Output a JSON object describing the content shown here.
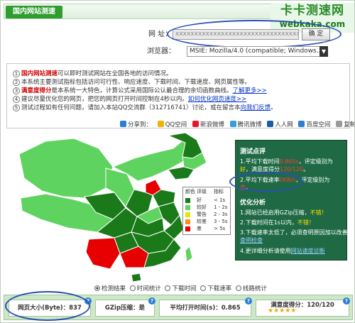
{
  "header": {
    "title": "国内网站测速",
    "logo_cn": "卡卡测速网",
    "logo_en": "webkaka.com"
  },
  "form": {
    "url_label": "网  址：",
    "url_value": "xxxxxxxxxxxxxxxxxxxxxxxxxxxxxxxxxxxx",
    "submit_label": "确 定",
    "browser_label": "浏览器：",
    "browser_value": "MSIE: Mozilla/4.0 (compatible; Windows..."
  },
  "info": {
    "lines": [
      {
        "num": "1",
        "strong": "国内网站测速",
        "rest": "可以即时测试网站在全国各地的访问情况。"
      },
      {
        "num": "2",
        "text": "本系统主要测试指标包括访问可行性、响应速度、下载时间、下载速度、网页属性等。"
      },
      {
        "num": "3",
        "strong": "满意度得分",
        "rest": "是本系统一大特色，计算公式采用国际公认最合理的余切函数曲线。",
        "link": "了解更多>>"
      },
      {
        "num": "4",
        "text": "建议尽量优化您的网页，把您的网页打开时间控制在4秒以内。",
        "link": "如何优化网页速度>>"
      },
      {
        "num": "5",
        "text": "测试过程如有任何问题，请加入本站QQ交流群（312716741）讨论，或在留言本",
        "link": "向我们反馈",
        "tail": "。"
      }
    ]
  },
  "share": {
    "label": "分享到：",
    "items": [
      "QQ空间",
      "新浪微博",
      "腾讯微博",
      "人人网",
      "百度空间",
      "复制"
    ]
  },
  "legend": {
    "headers": [
      "颜色",
      "评级",
      "指标"
    ],
    "rows": [
      {
        "rating": "好",
        "metric": "< 1s",
        "color": "#1a7a1a"
      },
      {
        "rating": "较好",
        "metric": "1 - 2s",
        "color": "#5fd35f"
      },
      {
        "rating": "警告",
        "metric": "2 - 3s",
        "color": "#e6e600"
      },
      {
        "rating": "较差",
        "metric": "3 - 5s",
        "color": "#ff8c1a"
      },
      {
        "rating": "差",
        "metric": "> 5s",
        "color": "#e60000"
      }
    ]
  },
  "result": {
    "title": "测试点评",
    "line1a": "1.平均下载时间",
    "line1_value": "0.865s",
    "line1b": "，评定级别为",
    "line1c": "好",
    "line1d": "，满意度得分",
    "line1_score": "120/120",
    "line1e": "。",
    "line2a": "2.平均下载速率",
    "line2_value": "0KB/s",
    "line2b": "，评定级别为",
    "line2c": "差",
    "line2d": "。",
    "opt_title": "优化分析",
    "opt1a": "1.网站已经启用GZip压缩，",
    "opt1b": "不错！",
    "opt2a": "2.下载时间在1s以内，",
    "opt2b": "不错！",
    "opt3a": "3.下载速率太低了，必须查明原因加以改善。",
    "opt3_link": "查明检查",
    "opt4a": "4.更详细分析请使用",
    "opt4_link": "网站速度诊断"
  },
  "tabs": {
    "items": [
      {
        "label": "检测结果",
        "selected": true
      },
      {
        "label": "时间统计",
        "selected": false
      },
      {
        "label": "下载时间",
        "selected": false
      },
      {
        "label": "下载速率",
        "selected": false
      },
      {
        "label": "线路统计",
        "selected": false
      }
    ]
  },
  "stats": {
    "page_size": "网页大小(Byte)：837",
    "gzip": "GZip压缩：是",
    "avg_open": "平均打开时间(s)：0.865",
    "satisfaction": "满意度得分：120/120",
    "stars": "★★★★★"
  }
}
